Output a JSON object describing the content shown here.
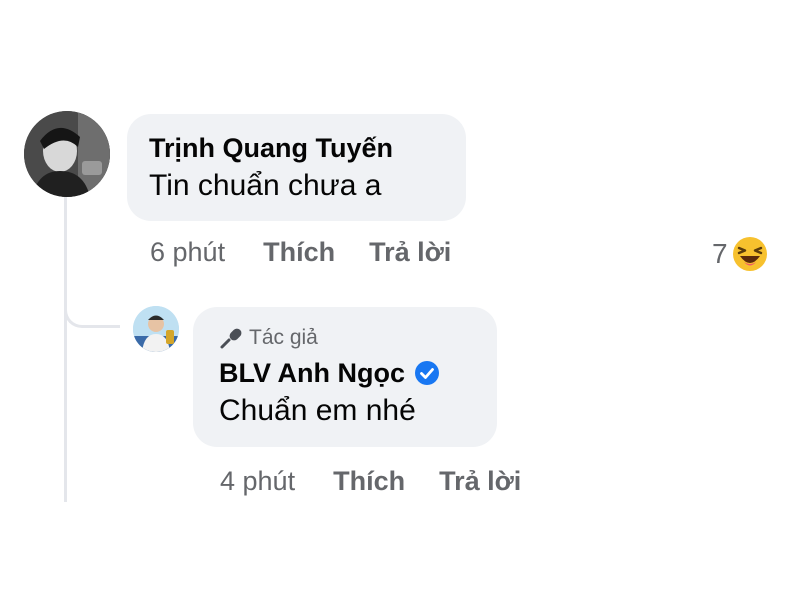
{
  "comment": {
    "author": "Trịnh Quang Tuyến",
    "text": "Tin chuẩn chưa a",
    "time": "6 phút",
    "like_label": "Thích",
    "reply_label": "Trả lời",
    "reaction_count": "7",
    "reaction_icon": "haha-emoji-icon"
  },
  "reply": {
    "badge": "Tác giả",
    "badge_icon": "microphone-icon",
    "author": "BLV Anh Ngọc",
    "verified_icon": "verified-badge-icon",
    "text": "Chuẩn em nhé",
    "time": "4 phút",
    "like_label": "Thích",
    "reply_label": "Trả lời"
  },
  "colors": {
    "bubble": "#f0f2f5",
    "secondary_text": "#65676b",
    "verified": "#1877f2",
    "thread_line": "#e4e6eb"
  }
}
